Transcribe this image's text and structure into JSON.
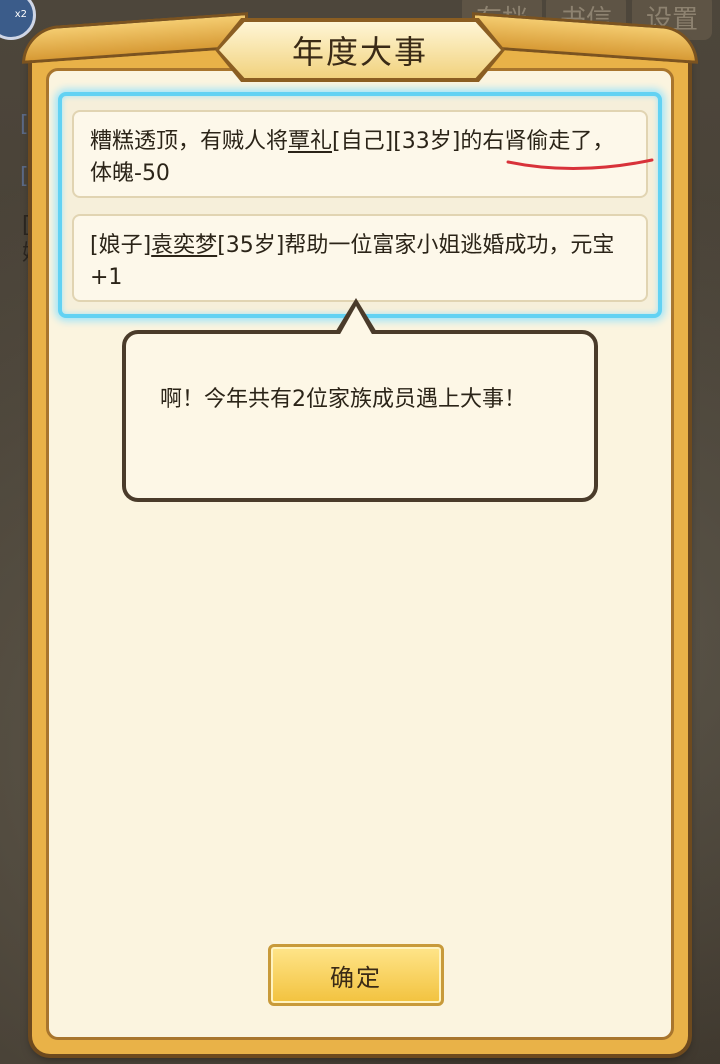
{
  "background": {
    "top_buttons": [
      "存档",
      "书信",
      "设置"
    ],
    "avatar_badge": "x2",
    "side_texts": [
      "[天",
      "[天"
    ],
    "side_dark_lines": [
      "[家",
      "娩"
    ]
  },
  "dialog": {
    "title": "年度大事",
    "events": [
      {
        "segments": [
          {
            "text": "糟糕透顶，有贼人将",
            "underline": false
          },
          {
            "text": "覃礼",
            "underline": true
          },
          {
            "text": "[自己][33岁]的右肾偷走了，体魄-50",
            "underline": false
          }
        ]
      },
      {
        "segments": [
          {
            "text": "[娘子]",
            "underline": false
          },
          {
            "text": "袁奕梦",
            "underline": true
          },
          {
            "text": "[35岁]帮助一位富家小姐逃婚成功，元宝+1",
            "underline": false
          }
        ]
      }
    ],
    "summary": "啊！今年共有2位家族成员遇上大事！",
    "confirm_label": "确定"
  },
  "colors": {
    "highlight": "#62d2f3",
    "panel_gold": "#e9b248",
    "annotation_red": "#d8323a"
  }
}
